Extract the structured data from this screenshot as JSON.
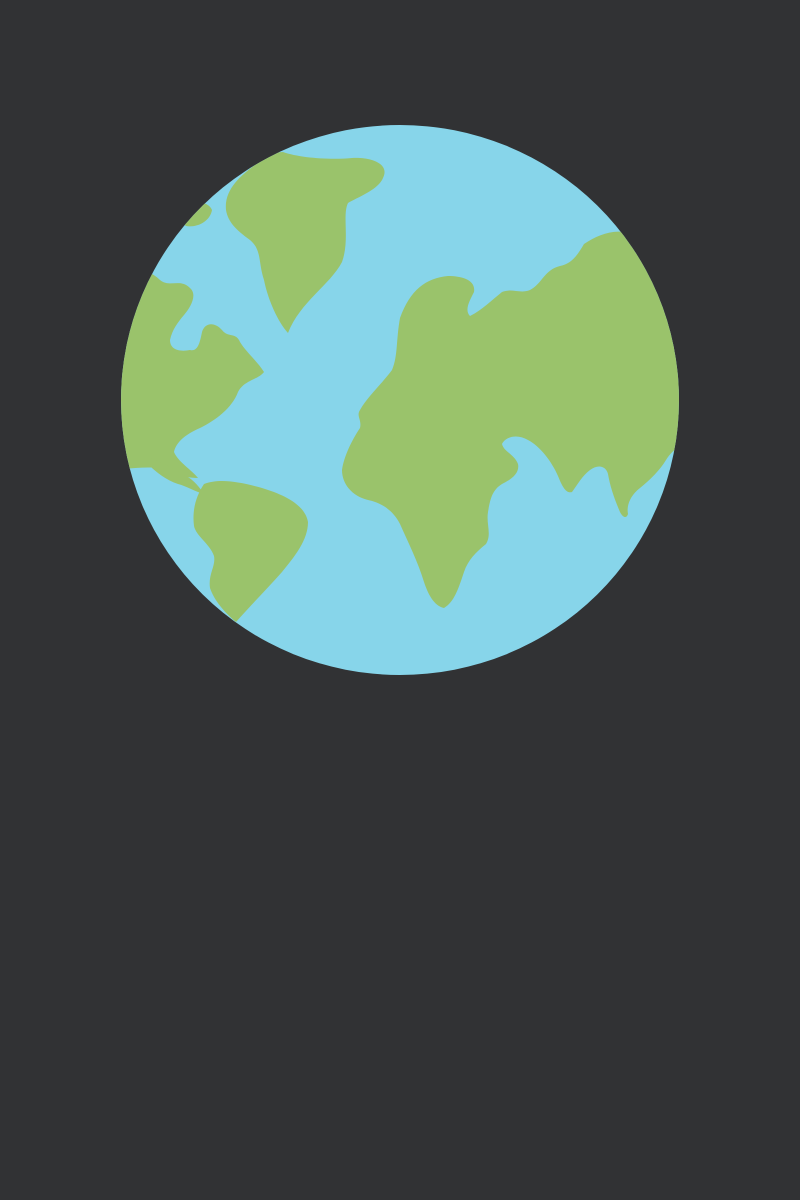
{
  "colors": {
    "background": "#313234",
    "ocean": "#87d5ea",
    "land": "#9ac36b"
  },
  "icon": "globe-icon"
}
